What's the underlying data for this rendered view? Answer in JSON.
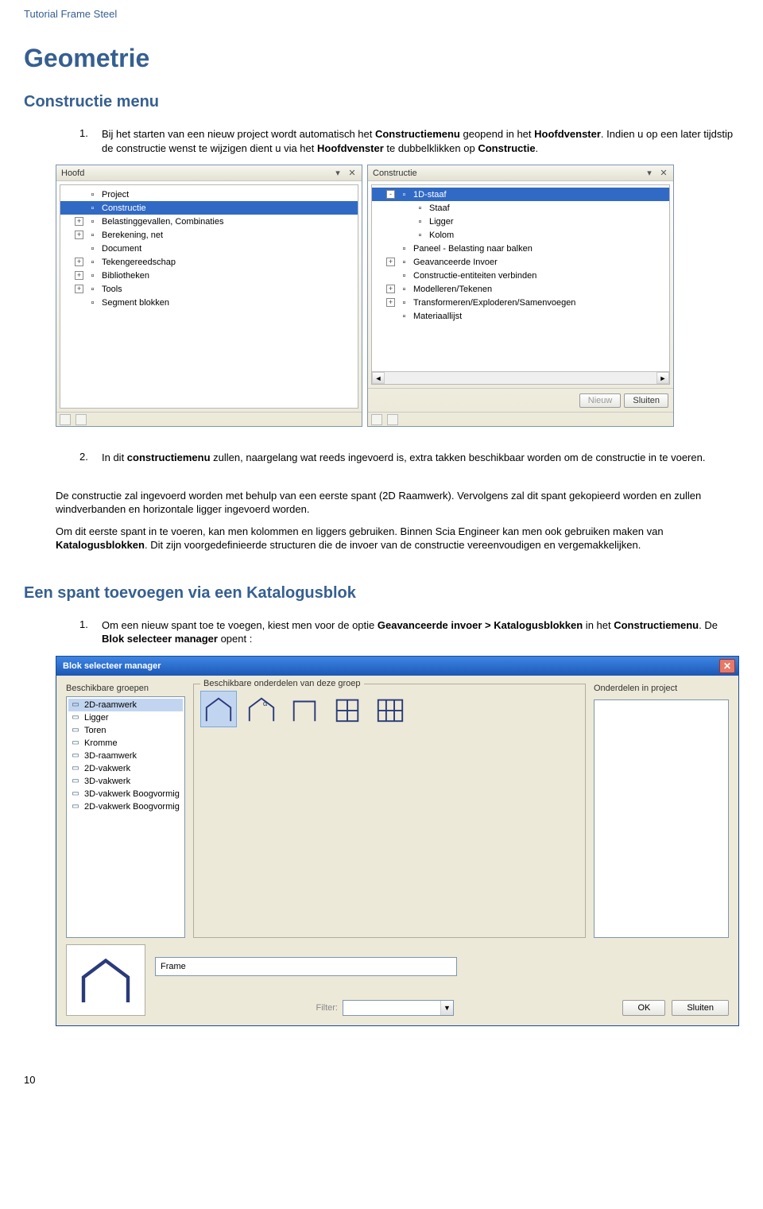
{
  "header": "Tutorial Frame Steel",
  "title": "Geometrie",
  "subtitle": "Constructie menu",
  "para1": {
    "num": "1.",
    "text_parts": [
      "Bij het starten van een nieuw project wordt automatisch het ",
      "Constructiemenu",
      " geopend in het ",
      "Hoofdvenster",
      ". Indien u op een later tijdstip de constructie wenst te wijzigen dient u via het ",
      "Hoofdvenster",
      " te dubbelklikken op ",
      "Constructie",
      "."
    ]
  },
  "panel_hoofd": {
    "title": "Hoofd",
    "items": [
      {
        "label": "Project",
        "level": 1,
        "sel": false,
        "exp": ""
      },
      {
        "label": "Constructie",
        "level": 1,
        "sel": true,
        "exp": ""
      },
      {
        "label": "Belastinggevallen, Combinaties",
        "level": 1,
        "sel": false,
        "exp": "+"
      },
      {
        "label": "Berekening, net",
        "level": 1,
        "sel": false,
        "exp": "+"
      },
      {
        "label": "Document",
        "level": 1,
        "sel": false,
        "exp": ""
      },
      {
        "label": "Tekengereedschap",
        "level": 1,
        "sel": false,
        "exp": "+"
      },
      {
        "label": "Bibliotheken",
        "level": 1,
        "sel": false,
        "exp": "+"
      },
      {
        "label": "Tools",
        "level": 1,
        "sel": false,
        "exp": "+"
      },
      {
        "label": "Segment blokken",
        "level": 1,
        "sel": false,
        "exp": ""
      }
    ]
  },
  "panel_constructie": {
    "title": "Constructie",
    "items": [
      {
        "label": "1D-staaf",
        "level": 1,
        "sel": true,
        "exp": "-"
      },
      {
        "label": "Staaf",
        "level": 2,
        "sel": false,
        "exp": ""
      },
      {
        "label": "Ligger",
        "level": 2,
        "sel": false,
        "exp": ""
      },
      {
        "label": "Kolom",
        "level": 2,
        "sel": false,
        "exp": ""
      },
      {
        "label": "Paneel - Belasting naar balken",
        "level": 1,
        "sel": false,
        "exp": ""
      },
      {
        "label": "Geavanceerde Invoer",
        "level": 1,
        "sel": false,
        "exp": "+"
      },
      {
        "label": "Constructie-entiteiten verbinden",
        "level": 1,
        "sel": false,
        "exp": ""
      },
      {
        "label": "Modelleren/Tekenen",
        "level": 1,
        "sel": false,
        "exp": "+"
      },
      {
        "label": "Transformeren/Exploderen/Samenvoegen",
        "level": 1,
        "sel": false,
        "exp": "+"
      },
      {
        "label": "Materiaallijst",
        "level": 1,
        "sel": false,
        "exp": ""
      }
    ],
    "btn_new": "Nieuw",
    "btn_close": "Sluiten"
  },
  "para2": {
    "num": "2.",
    "text_parts": [
      "In dit ",
      "constructiemenu",
      " zullen, naargelang wat reeds ingevoerd is, extra takken beschikbaar worden om de constructie in te voeren."
    ]
  },
  "para3": "De constructie zal ingevoerd worden met behulp van een eerste spant (2D Raamwerk). Vervolgens zal dit spant gekopieerd worden en zullen windverbanden en horizontale ligger ingevoerd worden.",
  "para4_parts": [
    "Om dit eerste spant in te voeren, kan men kolommen en liggers gebruiken. Binnen Scia Engineer kan men ook gebruiken maken van ",
    "Katalogusblokken",
    ". Dit zijn voorgedefinieerde structuren die de invoer van de constructie vereenvoudigen en vergemakkelijken."
  ],
  "section2": "Een spant toevoegen via een Katalogusblok",
  "para5": {
    "num": "1.",
    "text_parts": [
      "Om een nieuw spant toe te voegen, kiest men voor de optie ",
      "Geavanceerde invoer > Katalogusblokken",
      " in het ",
      "Constructiemenu",
      ". De ",
      "Blok selecteer manager",
      " opent :"
    ]
  },
  "dialog": {
    "title": "Blok selecteer manager",
    "groups_label": "Beschikbare groepen",
    "groups": [
      {
        "label": "2D-raamwerk",
        "sel": true
      },
      {
        "label": "Ligger",
        "sel": false
      },
      {
        "label": "Toren",
        "sel": false
      },
      {
        "label": "Kromme",
        "sel": false
      },
      {
        "label": "3D-raamwerk",
        "sel": false
      },
      {
        "label": "2D-vakwerk",
        "sel": false
      },
      {
        "label": "3D-vakwerk",
        "sel": false
      },
      {
        "label": "3D-vakwerk Boogvormig",
        "sel": false
      },
      {
        "label": "2D-vakwerk Boogvormig",
        "sel": false
      }
    ],
    "mid_label": "Beschikbare onderdelen van deze groep",
    "right_label": "Onderdelen in project",
    "frame_label": "Frame",
    "filter_label": "Filter:",
    "ok": "OK",
    "cancel": "Sluiten"
  },
  "pagenum": "10"
}
